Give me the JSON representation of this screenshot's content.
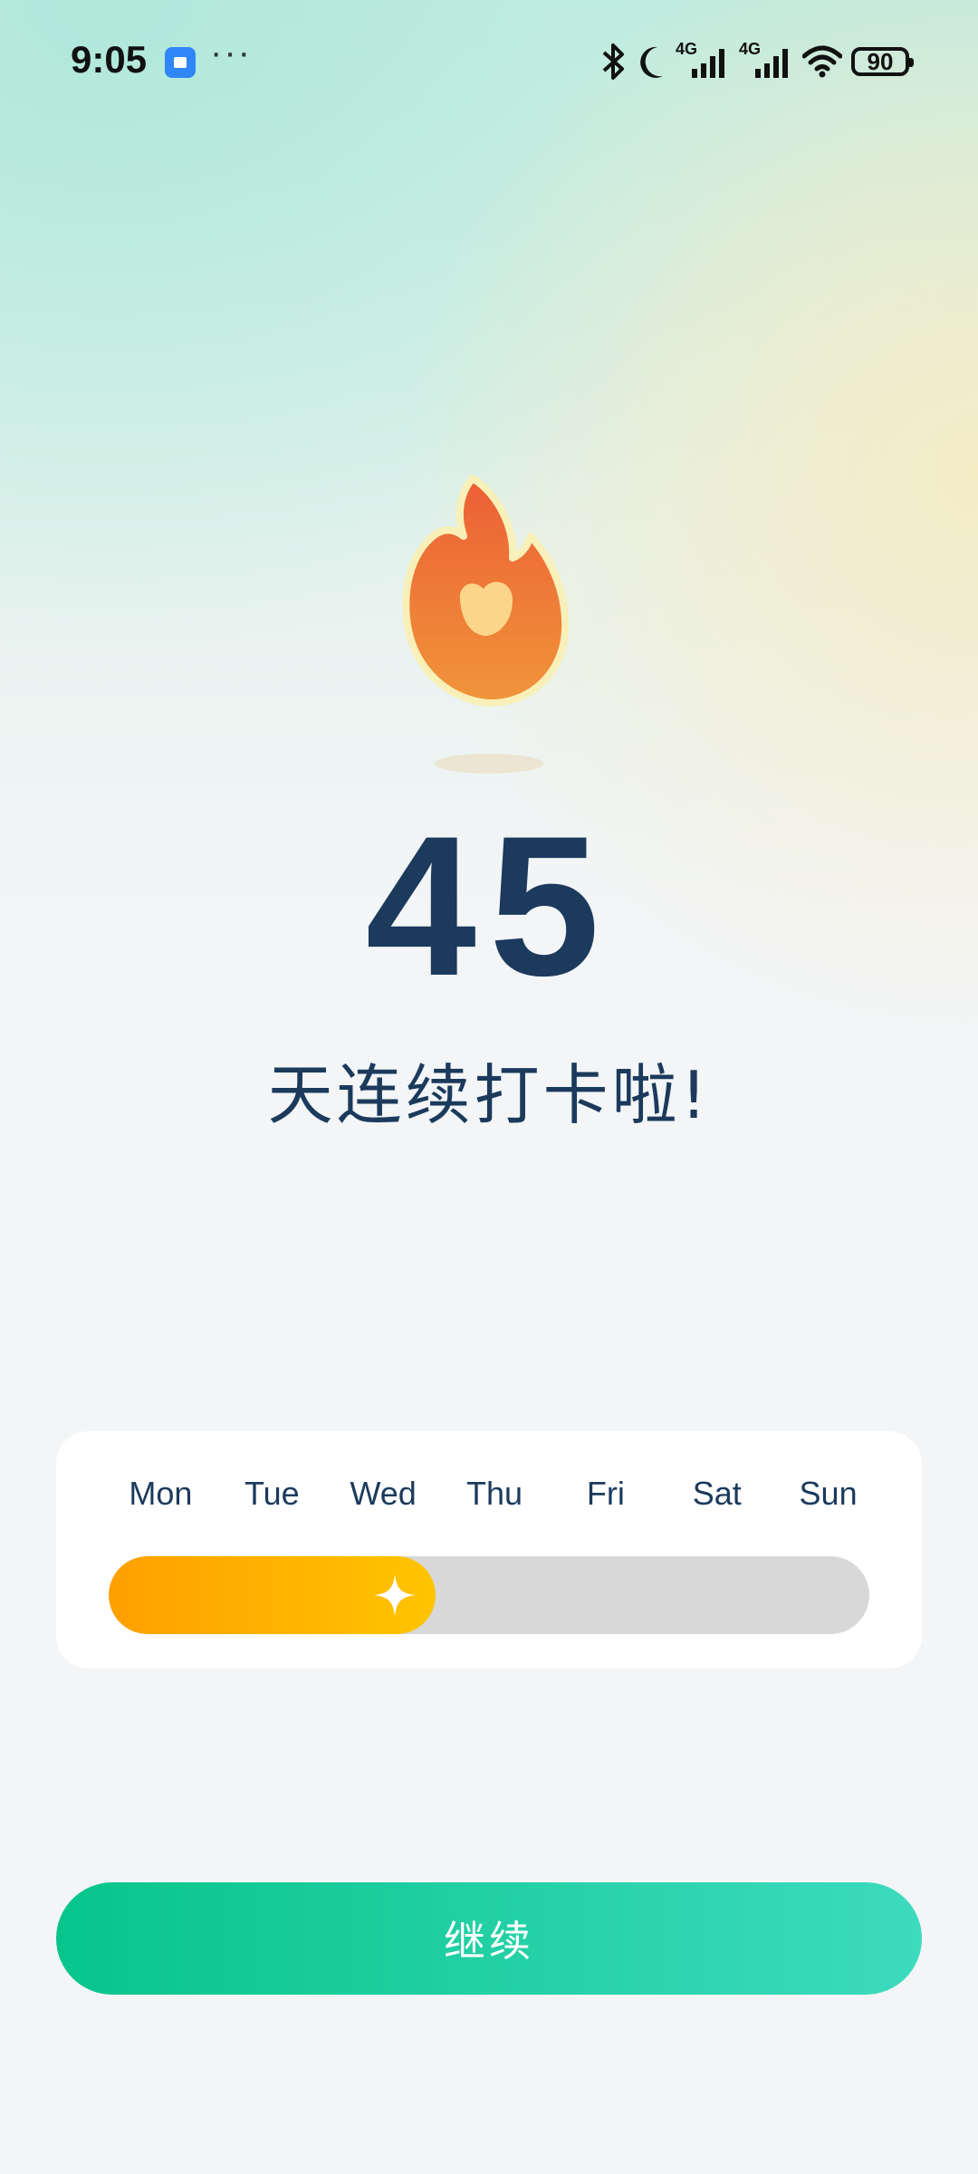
{
  "status_bar": {
    "time": "9:05",
    "icons": [
      "app-notification-icon",
      "more-dots-icon",
      "bluetooth-icon",
      "moon-icon",
      "4g-signal-icon",
      "4g-signal-icon",
      "wifi-icon",
      "battery-icon"
    ],
    "more": "···",
    "network_label_1": "4G",
    "network_label_2": "4G",
    "battery_level": "90"
  },
  "hero": {
    "icon": "flame-heart-icon",
    "streak_days": "45",
    "caption": "天连续打卡啦!"
  },
  "week": {
    "days": [
      "Mon",
      "Tue",
      "Wed",
      "Thu",
      "Fri",
      "Sat",
      "Sun"
    ],
    "progress_fraction": 0.43,
    "progress_marker_icon": "sparkle-icon",
    "fill_colors": [
      "#ffa000",
      "#ffc400"
    ],
    "track_color": "#d8d8d8"
  },
  "footer": {
    "continue_label": "继续",
    "button_colors": [
      "#07c58a",
      "#3ddbbe"
    ]
  },
  "colors": {
    "text_primary": "#1b3a5c"
  }
}
